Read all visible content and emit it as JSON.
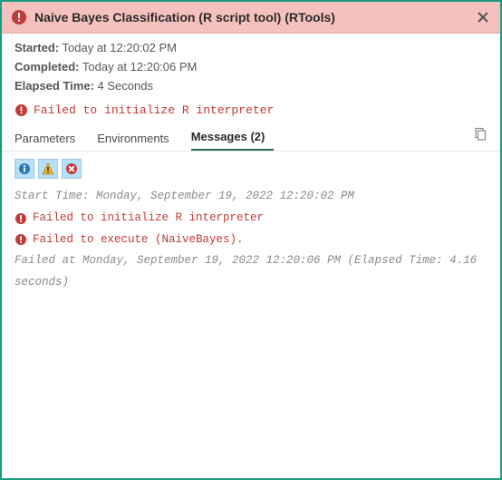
{
  "header": {
    "title": "Naive Bayes Classification (R script tool) (RTools)"
  },
  "meta": {
    "started_label": "Started:",
    "started_value": "Today at 12:20:02 PM",
    "completed_label": "Completed:",
    "completed_value": "Today at 12:20:06 PM",
    "elapsed_label": "Elapsed Time:",
    "elapsed_value": "4 Seconds"
  },
  "top_error": "Failed to initialize R interpreter",
  "tabs": {
    "parameters": "Parameters",
    "environments": "Environments",
    "messages": "Messages (2)"
  },
  "log": {
    "start_time": "Start Time: Monday, September 19, 2022 12:20:02 PM",
    "err1": "Failed to initialize R interpreter",
    "err2": "Failed to execute (NaiveBayes).",
    "end": "Failed at Monday, September 19, 2022 12:20:06 PM (Elapsed Time: 4.16 seconds)"
  }
}
